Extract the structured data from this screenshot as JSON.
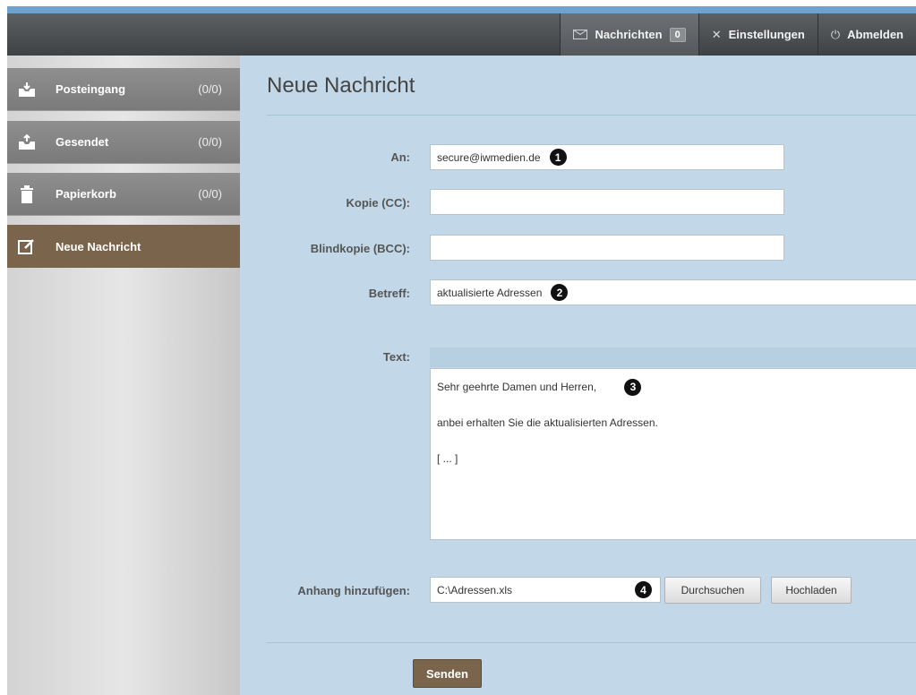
{
  "topbar": {
    "items": [
      {
        "label": "Nachrichten",
        "badge": "0",
        "icon": "mail-icon"
      },
      {
        "label": "Einstellungen",
        "icon": "settings-icon"
      },
      {
        "label": "Abmelden",
        "icon": "power-icon"
      }
    ]
  },
  "sidebar": {
    "items": [
      {
        "label": "Posteingang",
        "count": "(0/0)",
        "icon": "inbox-icon"
      },
      {
        "label": "Gesendet",
        "count": "(0/0)",
        "icon": "sent-icon"
      },
      {
        "label": "Papierkorb",
        "count": "(0/0)",
        "icon": "trash-icon"
      },
      {
        "label": "Neue Nachricht",
        "count": "",
        "icon": "compose-icon",
        "active": true
      }
    ]
  },
  "form": {
    "title": "Neue Nachricht",
    "to": {
      "label": "An:",
      "value": "secure@iwmedien.de",
      "marker": "1"
    },
    "cc": {
      "label": "Kopie (CC):",
      "value": ""
    },
    "bcc": {
      "label": "Blindkopie (BCC):",
      "value": ""
    },
    "subject": {
      "label": "Betreff:",
      "value": "aktualisierte Adressen",
      "marker": "2"
    },
    "text": {
      "label": "Text:",
      "lines": [
        "Sehr geehrte Damen und Herren,",
        "anbei erhalten Sie die aktualisierten Adressen.",
        "[ ... ]"
      ],
      "marker": "3"
    },
    "attachment": {
      "label": "Anhang hinzufügen:",
      "value": "C:\\Adressen.xls",
      "marker": "4",
      "browse_label": "Durchsuchen",
      "upload_label": "Hochladen"
    },
    "send_label": "Senden"
  },
  "colors": {
    "topbar": "#4a4d50",
    "accent_brown": "#7a654c",
    "content_bg": "#c2d8e8",
    "sidebar_item": "#858585"
  }
}
